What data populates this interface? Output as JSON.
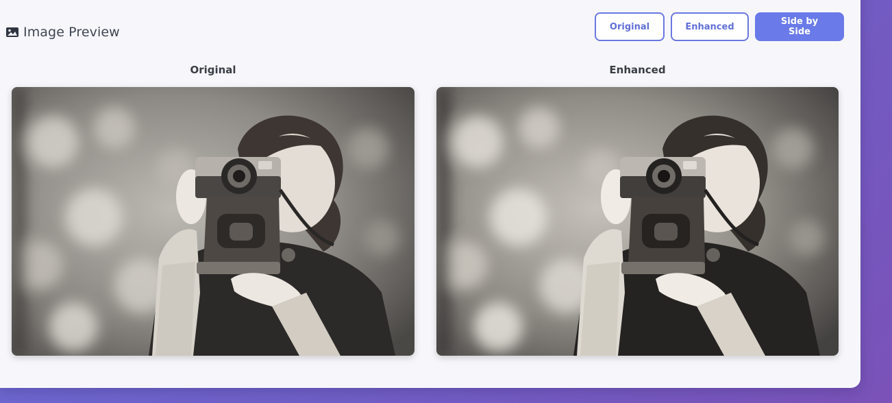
{
  "header": {
    "title": "Image Preview"
  },
  "view_modes": {
    "original_label": "Original",
    "enhanced_label": "Enhanced",
    "side_by_side_label": "Side by Side",
    "active": "Side by Side"
  },
  "comparison": {
    "left_label": "Original",
    "right_label": "Enhanced"
  },
  "colors": {
    "accent": "#6a7ae8",
    "panel_bg": "#f7f7fb",
    "page_gradient_start": "#6a6fd8",
    "page_gradient_end": "#7a52b8"
  }
}
